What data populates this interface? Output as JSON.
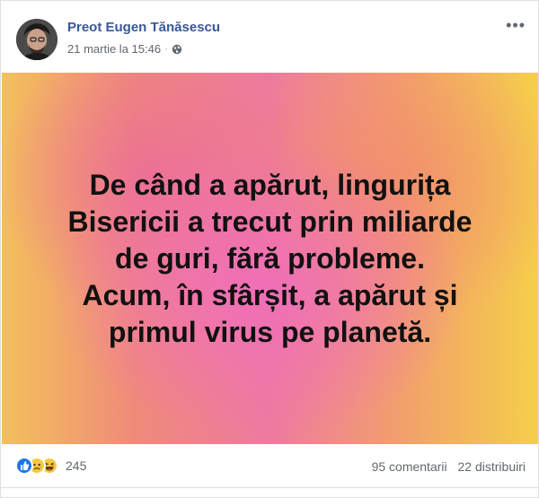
{
  "post": {
    "author": "Preot Eugen Tănăsescu",
    "date": "21 martie la 15:46",
    "separator": "·",
    "privacy_icon": "globe-icon",
    "more_icon": "more-options-icon",
    "more_label": "•••"
  },
  "image": {
    "lines": [
      "De când a apărut, lingurița",
      "Bisericii a trecut prin miliarde",
      "de guri, fără probleme.",
      "Acum, în sfârșit, a apărut și",
      "primul virus pe planetă."
    ]
  },
  "footer": {
    "reaction_icons": [
      "like-icon",
      "sad-icon",
      "haha-icon"
    ],
    "reaction_count": "245",
    "comments": "95 comentarii",
    "shares": "22 distribuiri"
  },
  "colors": {
    "author": "#385898",
    "meta": "#606770",
    "like": "#1877f2",
    "emoji": "#f7c83f"
  }
}
